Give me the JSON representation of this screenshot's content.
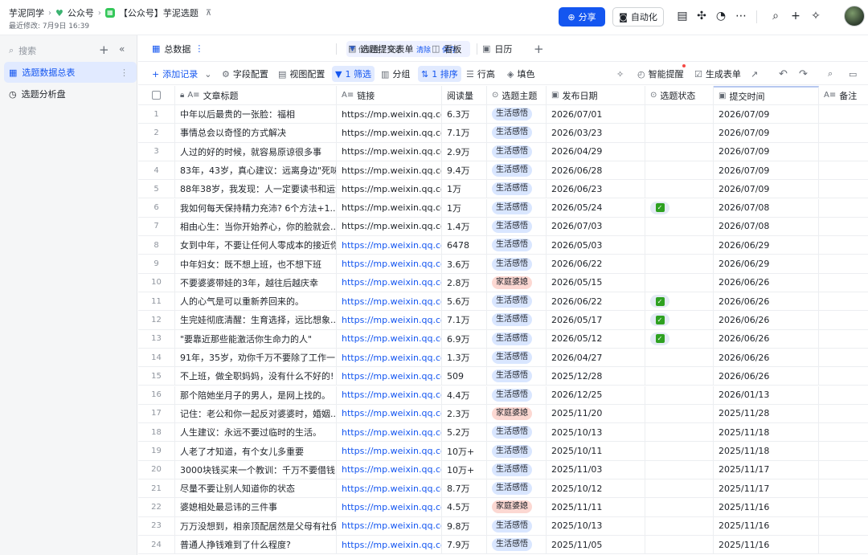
{
  "breadcrumb": {
    "workspace": "芋泥同学",
    "folder": "公众号",
    "doc": "【公众号】芋泥选题",
    "last_modified": "最近修改: 7月9日 16:39"
  },
  "header": {
    "share_label": "分享",
    "automation_label": "自动化"
  },
  "sidebar": {
    "search_placeholder": "搜索",
    "items": [
      {
        "label": "选题数据总表",
        "active": true
      },
      {
        "label": "选题分析盘",
        "active": false
      }
    ]
  },
  "view_tabs": {
    "current": "总数据",
    "filter_notice": "你调整了筛选",
    "clear_label": "清除",
    "save_label": "保存",
    "tabs": [
      "选题提交表单",
      "看板",
      "日历"
    ]
  },
  "toolbar": {
    "add_record": "添加记录",
    "field_config": "字段配置",
    "view_config": "视图配置",
    "filter": "1 筛选",
    "group": "分组",
    "sort": "1 排序",
    "row_height": "行高",
    "fill": "填色",
    "smart_alert": "智能提醒",
    "generate_form": "生成表单"
  },
  "table": {
    "columns": [
      "文章标题",
      "链接",
      "阅读量",
      "选题主题",
      "发布日期",
      "选题状态",
      "提交时间",
      "备注"
    ],
    "rows": [
      {
        "n": "1",
        "title": "中年以后最贵的一张脸：福相",
        "link": "https://mp.weixin.qq.co...",
        "reads": "6.3万",
        "topic": "生活感悟",
        "pub": "2026/07/01",
        "status": false,
        "submit": "2026/07/09"
      },
      {
        "n": "2",
        "title": "事情总会以奇怪的方式解决",
        "link": "https://mp.weixin.qq.co...",
        "reads": "7.1万",
        "topic": "生活感悟",
        "pub": "2026/03/23",
        "status": false,
        "submit": "2026/07/09"
      },
      {
        "n": "3",
        "title": "人过的好的时候，就容易原谅很多事",
        "link": "https://mp.weixin.qq.co...",
        "reads": "2.9万",
        "topic": "生活感悟",
        "pub": "2026/04/29",
        "status": false,
        "submit": "2026/07/09"
      },
      {
        "n": "4",
        "title": "83年，43岁，真心建议：远离身边\"死味...",
        "link": "https://mp.weixin.qq.co...",
        "reads": "9.4万",
        "topic": "生活感悟",
        "pub": "2026/06/28",
        "status": false,
        "submit": "2026/07/09"
      },
      {
        "n": "5",
        "title": "88年38岁，我发现：人一定要读书和运动",
        "link": "https://mp.weixin.qq.co...",
        "reads": "1万",
        "topic": "生活感悟",
        "pub": "2026/06/23",
        "status": false,
        "submit": "2026/07/09"
      },
      {
        "n": "6",
        "title": "我如何每天保持精力充沛? 6个方法+1...",
        "link": "https://mp.weixin.qq.co...",
        "reads": "1万",
        "topic": "生活感悟",
        "pub": "2026/05/24",
        "status": true,
        "submit": "2026/07/08"
      },
      {
        "n": "7",
        "title": "相由心生：当你开始养心，你的脸就会...",
        "link": "https://mp.weixin.qq.co...",
        "reads": "1.4万",
        "topic": "生活感悟",
        "pub": "2026/07/03",
        "status": false,
        "submit": "2026/07/08"
      },
      {
        "n": "8",
        "title": "女到中年，不要让任何人零成本的接近你",
        "link": "https://mp.weixin.qq.co...",
        "reads": "6478",
        "topic": "生活感悟",
        "pub": "2026/05/03",
        "status": false,
        "submit": "2026/06/29"
      },
      {
        "n": "9",
        "title": "中年妇女：既不想上班，也不想下班",
        "link": "https://mp.weixin.qq.co...",
        "reads": "3.6万",
        "topic": "生活感悟",
        "pub": "2026/06/22",
        "status": false,
        "submit": "2026/06/29"
      },
      {
        "n": "10",
        "title": "不要婆婆带娃的3年，越往后越庆幸",
        "link": "https://mp.weixin.qq.co...",
        "reads": "2.8万",
        "topic": "家庭婆媳",
        "pub": "2026/05/15",
        "status": false,
        "submit": "2026/06/26"
      },
      {
        "n": "11",
        "title": "人的心气是可以重新养回来的。",
        "link": "https://mp.weixin.qq.co...",
        "reads": "5.6万",
        "topic": "生活感悟",
        "pub": "2026/06/22",
        "status": true,
        "submit": "2026/06/26"
      },
      {
        "n": "12",
        "title": "生完娃彻底清醒：生育选择，远比想象...",
        "link": "https://mp.weixin.qq.co...",
        "reads": "7.1万",
        "topic": "生活感悟",
        "pub": "2026/05/17",
        "status": true,
        "submit": "2026/06/26"
      },
      {
        "n": "13",
        "title": "\"要靠近那些能激活你生命力的人\"",
        "link": "https://mp.weixin.qq.co...",
        "reads": "6.9万",
        "topic": "生活感悟",
        "pub": "2026/05/12",
        "status": true,
        "submit": "2026/06/26"
      },
      {
        "n": "14",
        "title": "91年，35岁，劝你千万不要除了工作一...",
        "link": "https://mp.weixin.qq.co...",
        "reads": "1.3万",
        "topic": "生活感悟",
        "pub": "2026/04/27",
        "status": false,
        "submit": "2026/06/26"
      },
      {
        "n": "15",
        "title": "不上班，做全职妈妈，没有什么不好的!",
        "link": "https://mp.weixin.qq.co...",
        "reads": "509",
        "topic": "生活感悟",
        "pub": "2025/12/28",
        "status": false,
        "submit": "2026/06/26"
      },
      {
        "n": "16",
        "title": "那个陪她坐月子的男人，是网上找的。",
        "link": "https://mp.weixin.qq.co...",
        "reads": "4.4万",
        "topic": "生活感悟",
        "pub": "2026/12/25",
        "status": false,
        "submit": "2026/01/13"
      },
      {
        "n": "17",
        "title": "记住：老公和你一起反对婆婆时，婚姻...",
        "link": "https://mp.weixin.qq.co...",
        "reads": "2.3万",
        "topic": "家庭婆媳",
        "pub": "2025/11/20",
        "status": false,
        "submit": "2025/11/28"
      },
      {
        "n": "18",
        "title": "人生建议：永远不要过临时的生活。",
        "link": "https://mp.weixin.qq.co...",
        "reads": "5.2万",
        "topic": "生活感悟",
        "pub": "2025/10/13",
        "status": false,
        "submit": "2025/11/18"
      },
      {
        "n": "19",
        "title": "人老了才知道，有个女儿多重要",
        "link": "https://mp.weixin.qq.co...",
        "reads": "10万+",
        "topic": "生活感悟",
        "pub": "2025/10/11",
        "status": false,
        "submit": "2025/11/18"
      },
      {
        "n": "20",
        "title": "3000块钱买来一个教训：千万不要借钱...",
        "link": "https://mp.weixin.qq.co...",
        "reads": "10万+",
        "topic": "生活感悟",
        "pub": "2025/11/03",
        "status": false,
        "submit": "2025/11/17"
      },
      {
        "n": "21",
        "title": "尽量不要让别人知道你的状态",
        "link": "https://mp.weixin.qq.co...",
        "reads": "8.7万",
        "topic": "生活感悟",
        "pub": "2025/10/12",
        "status": false,
        "submit": "2025/11/17"
      },
      {
        "n": "22",
        "title": "婆媳相处最忌讳的三件事",
        "link": "https://mp.weixin.qq.co...",
        "reads": "4.5万",
        "topic": "家庭婆媳",
        "pub": "2025/11/11",
        "status": false,
        "submit": "2025/11/16"
      },
      {
        "n": "23",
        "title": "万万没想到，相亲顶配居然是父母有社保",
        "link": "https://mp.weixin.qq.co...",
        "reads": "9.8万",
        "topic": "生活感悟",
        "pub": "2025/10/13",
        "status": false,
        "submit": "2025/11/16"
      },
      {
        "n": "24",
        "title": "普通人挣钱难到了什么程度?",
        "link": "https://mp.weixin.qq.co...",
        "reads": "7.9万",
        "topic": "生活感悟",
        "pub": "2025/11/05",
        "status": false,
        "submit": "2025/11/16"
      }
    ]
  },
  "colors": {
    "accent": "#1456f0",
    "tag_life": "#d9e6ff",
    "tag_family": "#fcd8d2"
  }
}
